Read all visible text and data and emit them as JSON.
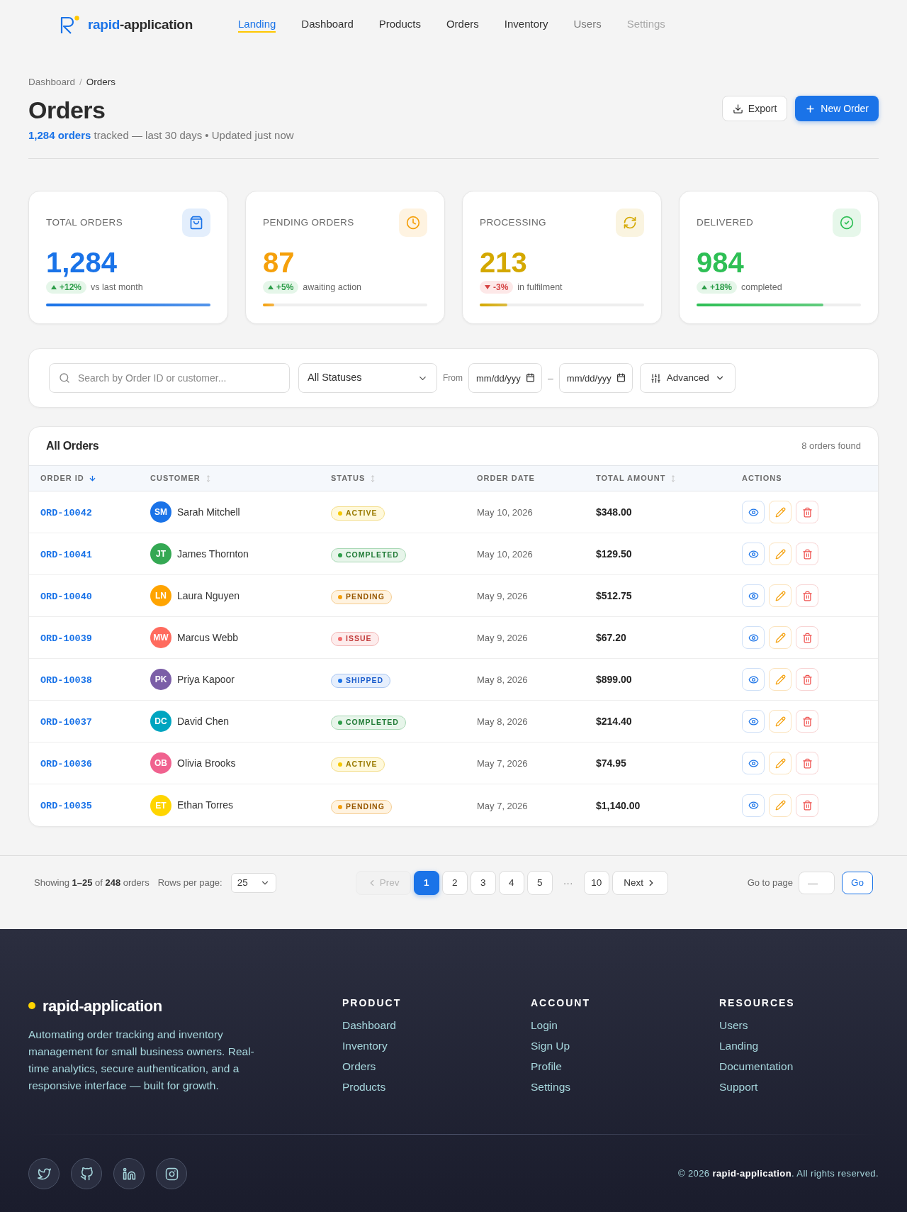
{
  "header": {
    "brand": {
      "accent": "rapid",
      "rest": "-application"
    },
    "nav": [
      {
        "label": "Landing",
        "selected": true,
        "kind": "link"
      },
      {
        "label": "Dashboard",
        "selected": false,
        "kind": "link"
      },
      {
        "label": "Products",
        "selected": false,
        "kind": "link"
      },
      {
        "label": "Orders",
        "selected": false,
        "kind": "link"
      },
      {
        "label": "Inventory",
        "selected": false,
        "kind": "link"
      },
      {
        "label": "Users",
        "selected": false,
        "kind": "muted"
      },
      {
        "label": "Settings",
        "selected": false,
        "kind": "disabled"
      }
    ]
  },
  "breadcrumb": {
    "separator": "/",
    "items": [
      {
        "label": "Dashboard",
        "current": false
      },
      {
        "label": "Orders",
        "current": true
      }
    ]
  },
  "page": {
    "title": "Orders",
    "subtitle": "**1,284 orders** tracked — last 30 days • Updated just now",
    "actions": [
      {
        "label": "Export",
        "kind": "secondary"
      },
      {
        "label": "New Order",
        "kind": "primary"
      }
    ]
  },
  "stats": [
    {
      "label": "TOTAL ORDERS",
      "value": "1,284",
      "color": "#1a73e8",
      "trend": {
        "text": "+12%",
        "kind": "up"
      },
      "note": "vs last month",
      "level": 1.0
    },
    {
      "label": "PENDING ORDERS",
      "value": "87",
      "color": "#f5a00b",
      "trend": {
        "text": "+5%",
        "kind": "up"
      },
      "note": "awaiting action",
      "level": 0.07
    },
    {
      "label": "PROCESSING",
      "value": "213",
      "color": "#d4a800",
      "trend": {
        "text": "-3%",
        "kind": "down"
      },
      "note": "in fulfilment",
      "level": 0.17
    },
    {
      "label": "DELIVERED",
      "value": "984",
      "color": "#2ebf55",
      "trend": {
        "text": "+18%",
        "kind": "up"
      },
      "note": "completed",
      "level": 0.77
    }
  ],
  "filters": {
    "search": {
      "placeholder": "Search by Order ID or customer..."
    },
    "status": {
      "value": "All Statuses"
    },
    "from_label": "From",
    "date_from": {
      "placeholder": "mm/dd/yyy"
    },
    "range_separator": "–",
    "date_to": {
      "placeholder": "mm/dd/yyy"
    },
    "advanced": {
      "label": "Advanced"
    }
  },
  "table": {
    "title": "All Orders",
    "count": "8 orders found",
    "columns": [
      {
        "label": "ORDER ID",
        "sortable": true,
        "sorted": true
      },
      {
        "label": "CUSTOMER",
        "sortable": true,
        "sorted": false
      },
      {
        "label": "STATUS",
        "sortable": true,
        "sorted": false
      },
      {
        "label": "ORDER DATE",
        "sortable": false,
        "sorted": false
      },
      {
        "label": "TOTAL AMOUNT",
        "sortable": true,
        "sorted": false
      },
      {
        "label": "ACTIONS",
        "sortable": false,
        "sorted": false
      }
    ],
    "rows": [
      {
        "id": "ORD-10042",
        "customer": {
          "initials": "SM",
          "name": "Sarah Mitchell",
          "color": "#1a73e8"
        },
        "status": {
          "label": "ACTIVE",
          "kind": "active"
        },
        "date": "May 10, 2026",
        "total": "$348.00"
      },
      {
        "id": "ORD-10041",
        "customer": {
          "initials": "JT",
          "name": "James Thornton",
          "color": "#34a853"
        },
        "status": {
          "label": "COMPLETED",
          "kind": "completed"
        },
        "date": "May 10, 2026",
        "total": "$129.50"
      },
      {
        "id": "ORD-10040",
        "customer": {
          "initials": "LN",
          "name": "Laura Nguyen",
          "color": "#ffa400"
        },
        "status": {
          "label": "PENDING",
          "kind": "pending"
        },
        "date": "May 9, 2026",
        "total": "$512.75"
      },
      {
        "id": "ORD-10039",
        "customer": {
          "initials": "MW",
          "name": "Marcus Webb",
          "color": "#ff6b5e"
        },
        "status": {
          "label": "ISSUE",
          "kind": "issue"
        },
        "date": "May 9, 2026",
        "total": "$67.20"
      },
      {
        "id": "ORD-10038",
        "customer": {
          "initials": "PK",
          "name": "Priya Kapoor",
          "color": "#7b5ea7"
        },
        "status": {
          "label": "SHIPPED",
          "kind": "shipped"
        },
        "date": "May 8, 2026",
        "total": "$899.00"
      },
      {
        "id": "ORD-10037",
        "customer": {
          "initials": "DC",
          "name": "David Chen",
          "color": "#00a5c0"
        },
        "status": {
          "label": "COMPLETED",
          "kind": "completed"
        },
        "date": "May 8, 2026",
        "total": "$214.40"
      },
      {
        "id": "ORD-10036",
        "customer": {
          "initials": "OB",
          "name": "Olivia Brooks",
          "color": "#f0628f"
        },
        "status": {
          "label": "ACTIVE",
          "kind": "active"
        },
        "date": "May 7, 2026",
        "total": "$74.95"
      },
      {
        "id": "ORD-10035",
        "customer": {
          "initials": "ET",
          "name": "Ethan Torres",
          "color": "#ffd500"
        },
        "status": {
          "label": "PENDING",
          "kind": "pending"
        },
        "date": "May 7, 2026",
        "total": "$1,140.00"
      }
    ]
  },
  "pagination": {
    "summary": "Showing **1–25** of **248** orders",
    "rows_label": "Rows per page:",
    "rows_value": "25",
    "prev": {
      "label": "Prev",
      "disabled": true
    },
    "pages": [
      {
        "kind": "page",
        "label": "1",
        "selected": true
      },
      {
        "kind": "page",
        "label": "2",
        "selected": false
      },
      {
        "kind": "page",
        "label": "3",
        "selected": false
      },
      {
        "kind": "page",
        "label": "4",
        "selected": false
      },
      {
        "kind": "page",
        "label": "5",
        "selected": false
      },
      {
        "kind": "ellipsis",
        "label": "···"
      },
      {
        "kind": "page",
        "label": "10",
        "selected": false
      }
    ],
    "next": {
      "label": "Next"
    },
    "goto": {
      "label": "Go to page",
      "placeholder": "—",
      "button": "Go"
    }
  },
  "footer": {
    "brand": "rapid-application",
    "description": "Automating order tracking and inventory management for small business owners. Real-time analytics, secure authentication, and a responsive interface — built for growth.",
    "columns": [
      {
        "heading": "PRODUCT",
        "links": [
          "Dashboard",
          "Inventory",
          "Orders",
          "Products"
        ]
      },
      {
        "heading": "ACCOUNT",
        "links": [
          "Login",
          "Sign Up",
          "Profile",
          "Settings"
        ]
      },
      {
        "heading": "RESOURCES",
        "links": [
          "Users",
          "Landing",
          "Documentation",
          "Support"
        ]
      }
    ],
    "copyright": "© 2026 **rapid-application**. All rights reserved."
  }
}
